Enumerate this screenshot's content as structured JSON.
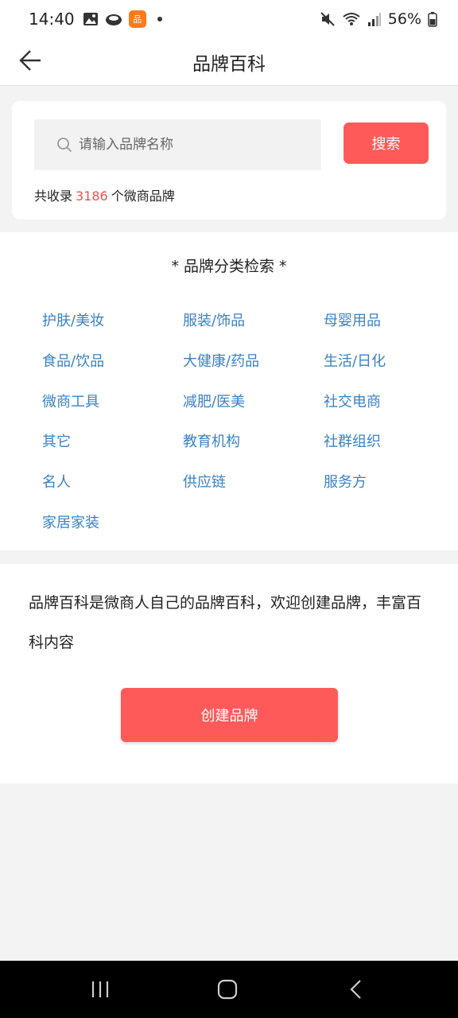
{
  "status_bar": {
    "time": "14:40",
    "battery_text": "56%",
    "app_badge_label": "品"
  },
  "app_bar": {
    "title": "品牌百科"
  },
  "search": {
    "placeholder": "请输入品牌名称",
    "button_label": "搜索",
    "count_prefix": "共收录",
    "count_value": "3186",
    "count_suffix": "个微商品牌"
  },
  "categories": {
    "title": "* 品牌分类检索 *",
    "items": [
      "护肤/美妆",
      "服装/饰品",
      "母婴用品",
      "食品/饮品",
      "大健康/药品",
      "生活/日化",
      "微商工具",
      "减肥/医美",
      "社交电商",
      "其它",
      "教育机构",
      "社群组织",
      "名人",
      "供应链",
      "服务方",
      "家居家装"
    ]
  },
  "intro": {
    "text": "品牌百科是微商人自己的品牌百科，欢迎创建品牌，丰富百科内容",
    "create_button_label": "创建品牌"
  },
  "colors": {
    "accent": "#ff5a5a",
    "category_link": "#3b82c4",
    "count_highlight": "#e8554e"
  }
}
